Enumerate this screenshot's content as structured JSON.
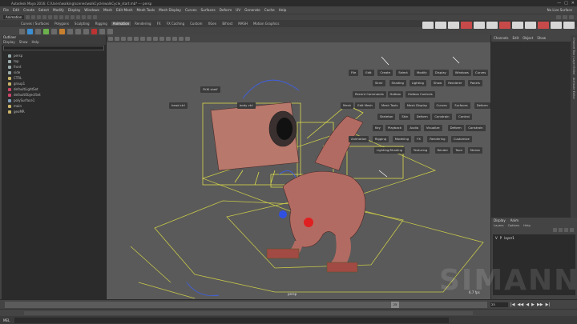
{
  "window": {
    "title": "Autodesk Maya 2016: C:\\Users\\walking\\scenes\\walkCycle\\walkCycle_start.mb* --- persp",
    "controls": [
      "—",
      "□",
      "✕"
    ]
  },
  "menubar": {
    "items": [
      "File",
      "Edit",
      "Create",
      "Select",
      "Modify",
      "Display",
      "Windows",
      "Mesh",
      "Edit Mesh",
      "Mesh Tools",
      "Mesh Display",
      "Curves",
      "Surfaces",
      "Deform",
      "UV",
      "Generate",
      "Cache",
      "Help"
    ],
    "workspace": "No Live Surface"
  },
  "statusline": {
    "menuset": "Animation"
  },
  "shelf": {
    "tabs": [
      "Curves / Surfaces",
      "Polygons",
      "Sculpting",
      "Rigging",
      "Animation",
      "Rendering",
      "FX",
      "FX Caching",
      "Custom",
      "XGen",
      "Bifrost",
      "MASH",
      "Motion Graphics"
    ],
    "active_tab": "Animation"
  },
  "outliner": {
    "title": "Outliner",
    "menu": [
      "Display",
      "Show",
      "Help"
    ],
    "items": [
      {
        "label": "persp",
        "type": "cam"
      },
      {
        "label": "top",
        "type": "cam"
      },
      {
        "label": "front",
        "type": "cam"
      },
      {
        "label": "side",
        "type": "cam"
      },
      {
        "label": "CTRL",
        "type": "grp"
      },
      {
        "label": "group1",
        "type": "grp"
      },
      {
        "label": "defaultLightSet",
        "type": "set"
      },
      {
        "label": "defaultObjectSet",
        "type": "set"
      },
      {
        "label": "polySurface1",
        "type": "mesh"
      },
      {
        "label": "main",
        "type": "grp"
      },
      {
        "label": "geoMR",
        "type": "grp"
      }
    ]
  },
  "viewport": {
    "menu": [
      "View",
      "Shading",
      "Lighting",
      "Show",
      "Renderer",
      "Panels"
    ],
    "camera_label": "persp",
    "fps": "6.7 fps",
    "grid_color": "#c8c84a",
    "floating_labels": [
      "FKIK shelf",
      "head ctrl",
      "body ctrl"
    ]
  },
  "hotbox": {
    "rows": [
      [
        "File",
        "Edit",
        "Create",
        "Select",
        "Modify",
        "Display",
        "Windows",
        "Curves",
        "Rootfx",
        "Help"
      ],
      [
        "Skinr",
        "Shading",
        "Lighting",
        "Show",
        "Renderer",
        "Panels"
      ],
      [
        "Recent Commands",
        "Hotbox",
        "Hotbox Controls"
      ],
      [
        "Mesh",
        "Edit Mesh",
        "Mesh Tools",
        "Mesh Display",
        "Curves",
        "Surfaces",
        "Deform",
        "UV",
        "Generate"
      ],
      [
        "Skeleton",
        "Skin",
        "Deform",
        "Constrain",
        "Control"
      ],
      [
        "Key",
        "Playback",
        "Audio",
        "Visualize",
        "Deform",
        "Constrain"
      ],
      [
        "Animation",
        "Rigging",
        "Modeling",
        "FX",
        "Rendering",
        "Customize"
      ],
      [
        "Lighting/Shading",
        "Texturing",
        "Render",
        "Toon",
        "Stereo"
      ]
    ]
  },
  "channelbox": {
    "menu": [
      "Channels",
      "Edit",
      "Object",
      "Show"
    ],
    "side_tabs": [
      "Channel Box / Layer Editor",
      "Attribute Editor",
      "Tool Settings",
      "Modeling Toolkit"
    ]
  },
  "layer_editor": {
    "tabs": [
      "Display",
      "Anim"
    ],
    "menu": [
      "Layers",
      "Options",
      "Help"
    ],
    "layers": [
      {
        "v": "V",
        "p": "P",
        "name": "layer1"
      }
    ]
  },
  "timeline": {
    "current_frame": "25",
    "start_field": "25",
    "buttons": [
      "|◀",
      "◀◀",
      "◀",
      "▶",
      "▶▶",
      "▶|"
    ]
  },
  "commandline": {
    "label": "MEL"
  },
  "watermark": "SIMANN"
}
